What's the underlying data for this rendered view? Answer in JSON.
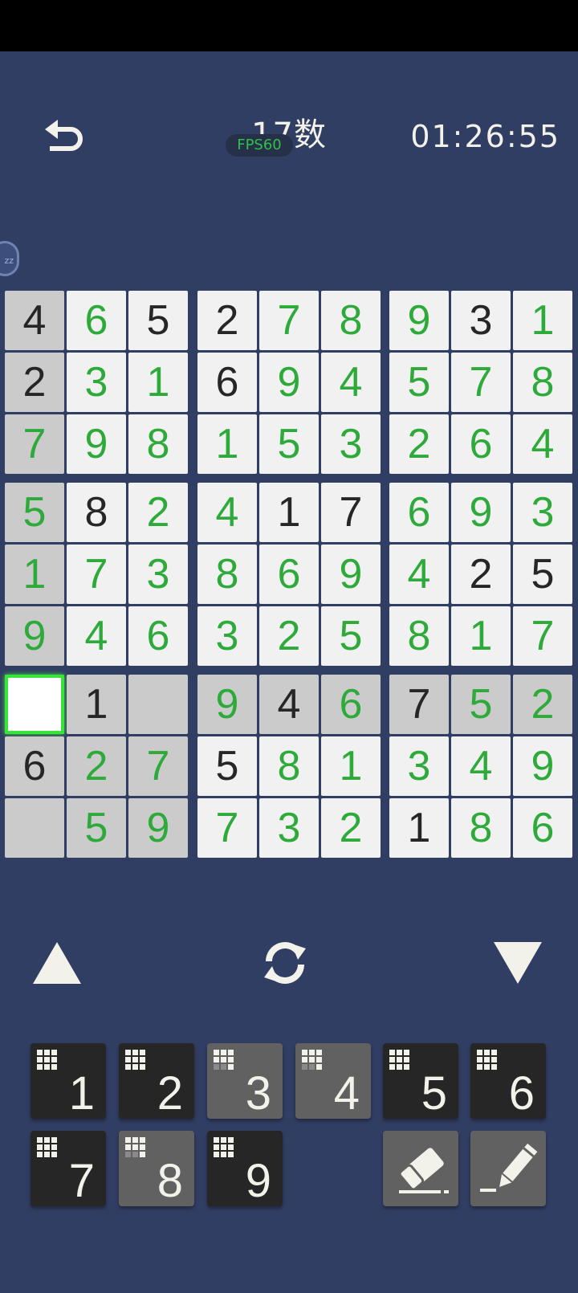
{
  "header": {
    "title": "17数",
    "fps_badge": "FPS60",
    "timer": "01:26:55",
    "pause_badge": "zz"
  },
  "icons": {
    "back": "back-arrow-icon",
    "undo": "up-triangle-icon",
    "refresh": "refresh-cycle-icon",
    "redo": "down-triangle-icon",
    "eraser": "eraser-icon",
    "pencil": "pencil-icon"
  },
  "colors": {
    "background": "#313e63",
    "given_digit": "#262626",
    "entered_digit": "#2eaa3a",
    "selection_glow": "#39e339",
    "cell_white": "#f1f1f1",
    "cell_highlight": "#cbcbcb"
  },
  "grid": {
    "rows": [
      [
        "4",
        "6",
        "5",
        "2",
        "7",
        "8",
        "9",
        "3",
        "1"
      ],
      [
        "2",
        "3",
        "1",
        "6",
        "9",
        "4",
        "5",
        "7",
        "8"
      ],
      [
        "7",
        "9",
        "8",
        "1",
        "5",
        "3",
        "2",
        "6",
        "4"
      ],
      [
        "5",
        "8",
        "2",
        "4",
        "1",
        "7",
        "6",
        "9",
        "3"
      ],
      [
        "1",
        "7",
        "3",
        "8",
        "6",
        "9",
        "4",
        "2",
        "5"
      ],
      [
        "9",
        "4",
        "6",
        "3",
        "2",
        "5",
        "8",
        "1",
        "7"
      ],
      [
        "",
        "1",
        "",
        "9",
        "4",
        "6",
        "7",
        "5",
        "2"
      ],
      [
        "6",
        "2",
        "7",
        "5",
        "8",
        "1",
        "3",
        "4",
        "9"
      ],
      [
        "",
        "5",
        "9",
        "7",
        "3",
        "2",
        "1",
        "8",
        "6"
      ]
    ],
    "given": [
      [
        1,
        0,
        1,
        1,
        0,
        0,
        0,
        1,
        0
      ],
      [
        1,
        0,
        0,
        1,
        0,
        0,
        0,
        0,
        0
      ],
      [
        0,
        0,
        0,
        0,
        0,
        0,
        0,
        0,
        0
      ],
      [
        0,
        1,
        0,
        0,
        1,
        1,
        0,
        0,
        0
      ],
      [
        0,
        0,
        0,
        0,
        0,
        0,
        0,
        1,
        1
      ],
      [
        0,
        0,
        0,
        0,
        0,
        0,
        0,
        0,
        0
      ],
      [
        0,
        1,
        0,
        0,
        1,
        0,
        1,
        0,
        0
      ],
      [
        1,
        0,
        0,
        1,
        0,
        0,
        0,
        0,
        0
      ],
      [
        0,
        0,
        0,
        0,
        0,
        0,
        1,
        0,
        0
      ]
    ],
    "highlighted": [
      [
        1,
        0,
        0,
        0,
        0,
        0,
        0,
        0,
        0
      ],
      [
        1,
        0,
        0,
        0,
        0,
        0,
        0,
        0,
        0
      ],
      [
        1,
        0,
        0,
        0,
        0,
        0,
        0,
        0,
        0
      ],
      [
        1,
        0,
        0,
        0,
        0,
        0,
        0,
        0,
        0
      ],
      [
        1,
        0,
        0,
        0,
        0,
        0,
        0,
        0,
        0
      ],
      [
        1,
        0,
        0,
        0,
        0,
        0,
        0,
        0,
        0
      ],
      [
        1,
        1,
        1,
        1,
        1,
        1,
        1,
        1,
        1
      ],
      [
        1,
        1,
        1,
        0,
        0,
        0,
        0,
        0,
        0
      ],
      [
        1,
        1,
        1,
        0,
        0,
        0,
        0,
        0,
        0
      ]
    ],
    "selected": {
      "row": 7,
      "col": 1
    }
  },
  "keypad": [
    {
      "label": "1",
      "done": false
    },
    {
      "label": "2",
      "done": false
    },
    {
      "label": "3",
      "done": true
    },
    {
      "label": "4",
      "done": true
    },
    {
      "label": "5",
      "done": false
    },
    {
      "label": "6",
      "done": false
    },
    {
      "label": "7",
      "done": false
    },
    {
      "label": "8",
      "done": true
    },
    {
      "label": "9",
      "done": false
    }
  ]
}
